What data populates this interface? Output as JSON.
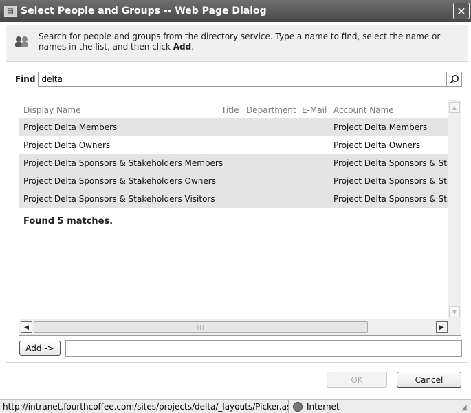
{
  "window": {
    "title": "Select People and Groups -- Web Page Dialog",
    "close_glyph": "✕"
  },
  "intro": {
    "text_before": "Search for people and groups from the directory service. Type a name to find, select the name or names in the list, and then click ",
    "text_bold": "Add",
    "text_after": "."
  },
  "find": {
    "label": "Find",
    "value": "delta"
  },
  "grid": {
    "columns": [
      "Display Name",
      "Title",
      "Department",
      "E-Mail",
      "Account Name"
    ],
    "rows": [
      {
        "display_name": "Project Delta Members",
        "account_name": "Project Delta Members"
      },
      {
        "display_name": "Project Delta Owners",
        "account_name": "Project Delta Owners"
      },
      {
        "display_name": "Project Delta Sponsors & Stakeholders Members",
        "account_name": "Project Delta Sponsors & Sta"
      },
      {
        "display_name": "Project Delta Sponsors & Stakeholders Owners",
        "account_name": "Project Delta Sponsors & Sta"
      },
      {
        "display_name": "Project Delta Sponsors & Stakeholders Visitors",
        "account_name": "Project Delta Sponsors & Sta"
      }
    ],
    "found_text": "Found 5 matches."
  },
  "add": {
    "button_label": "Add ->",
    "value": ""
  },
  "buttons": {
    "ok": "OK",
    "cancel": "Cancel"
  },
  "status": {
    "url": "http://intranet.fourthcoffee.com/sites/projects/delta/_layouts/Picker.as",
    "zone": "Internet"
  }
}
